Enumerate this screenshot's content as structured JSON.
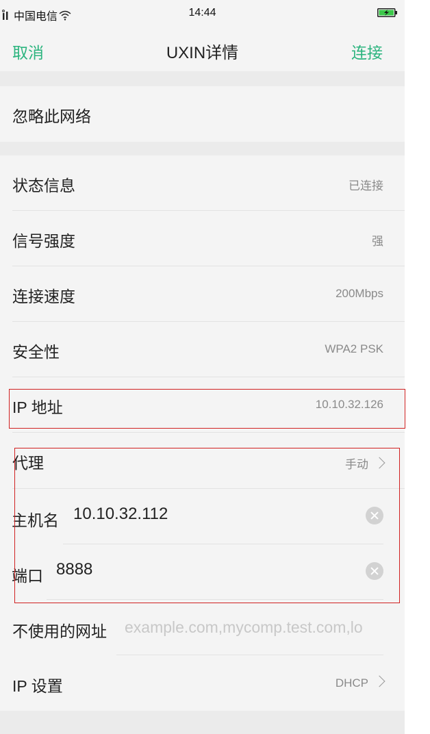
{
  "status_bar": {
    "carrier": "中国电信",
    "time": "14:44"
  },
  "nav": {
    "cancel_label": "取消",
    "title": "UXIN详情",
    "connect_label": "连接"
  },
  "forget": {
    "label": "忽略此网络"
  },
  "info_rows": [
    {
      "label": "状态信息",
      "value": "已连接"
    },
    {
      "label": "信号强度",
      "value": "强"
    },
    {
      "label": "连接速度",
      "value": "200Mbps"
    },
    {
      "label": "安全性",
      "value": "WPA2 PSK"
    },
    {
      "label": "IP 地址",
      "value": "10.10.32.126"
    }
  ],
  "proxy": {
    "label": "代理",
    "value": "手动",
    "hostname_label": "主机名",
    "hostname_value": "10.10.32.112",
    "port_label": "端口",
    "port_value": "8888",
    "bypass_label": "不使用的网址",
    "bypass_placeholder": "example.com,mycomp.test.com,lo"
  },
  "ip_settings": {
    "label": "IP 设置",
    "value": "DHCP"
  },
  "colors": {
    "accent": "#2bb47e",
    "highlight": "#d02020"
  }
}
